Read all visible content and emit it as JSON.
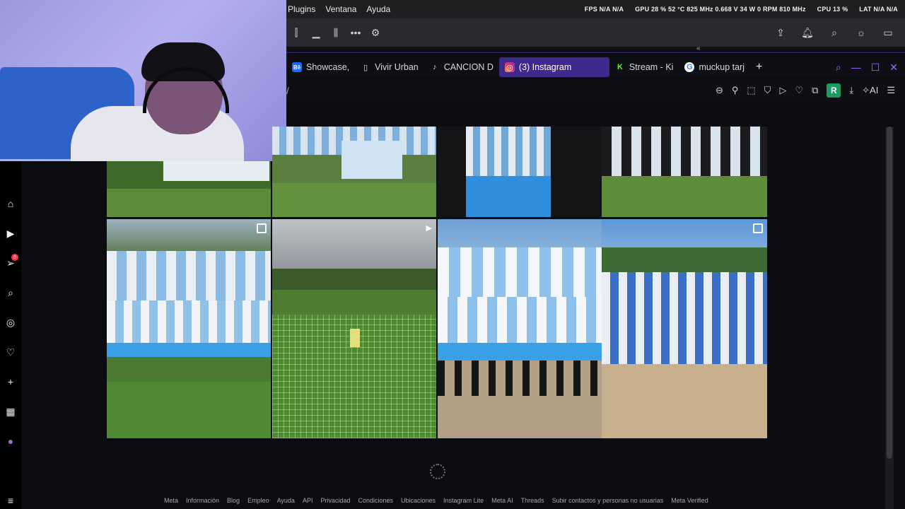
{
  "menubar": {
    "items": [
      "Plugins",
      "Ventana",
      "Ayuda"
    ],
    "stats": {
      "fps": "FPS N/A N/A",
      "gpu": "GPU 28 % 52 °C 825 MHz 0.668 V 34 W 0 RPM 810 MHz",
      "cpu": "CPU 13 %",
      "lat": "LAT N/A N/A"
    }
  },
  "tabs": [
    {
      "label": "Showcase,",
      "icon": "behance-icon"
    },
    {
      "label": "Vivir Urban",
      "icon": "document-icon"
    },
    {
      "label": "CANCION D",
      "icon": "music-icon"
    },
    {
      "label": "(3) Instagram",
      "icon": "instagram-icon",
      "active": true
    },
    {
      "label": "Stream - Ki",
      "icon": "kick-icon"
    },
    {
      "label": "muckup tarj",
      "icon": "google-icon"
    }
  ],
  "address": {
    "url": "/"
  },
  "extension_badge": "R",
  "ai_label": "AI",
  "notification_count": "8",
  "footer_links": [
    "Meta",
    "Información",
    "Blog",
    "Empleo",
    "Ayuda",
    "API",
    "Privacidad",
    "Condiciones",
    "Ubicaciones",
    "Instagram Lite",
    "Meta AI",
    "Threads",
    "Subir contactos y personas no usuarias",
    "Meta Verified"
  ],
  "colors": {
    "accent": "#3d2a8c",
    "badge": "#ff3040",
    "extension": "#1e9a63"
  }
}
